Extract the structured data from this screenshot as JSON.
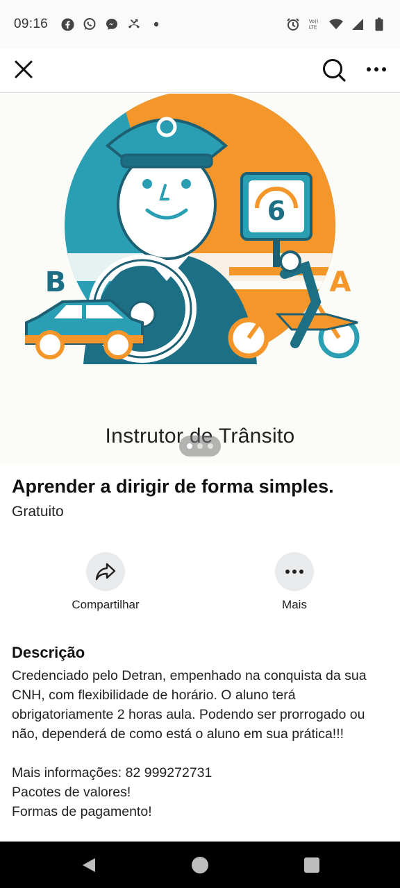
{
  "status_bar": {
    "time": "09:16",
    "left_icons": [
      "facebook-icon",
      "whatsapp-icon",
      "messenger-icon",
      "missed-call-icon",
      "dot-icon"
    ],
    "right_icons": [
      "alarm-icon",
      "volte-icon",
      "wifi-icon",
      "signal-icon",
      "battery-icon"
    ],
    "volte_label": "Vo)) LTE"
  },
  "app_bar": {
    "close_icon": "close-icon",
    "search_icon": "search-icon",
    "more_icon": "more-horizontal-icon"
  },
  "hero": {
    "caption": "Instrutor de Trânsito",
    "badge_number": "6",
    "left_letter": "B",
    "right_letter": "A",
    "pager": {
      "count": 3,
      "active_index": 0
    },
    "colors": {
      "teal": "#2a9fb4",
      "orange": "#f5962a",
      "navy": "#1d5f73"
    }
  },
  "listing": {
    "title": "Aprender a dirigir de forma simples.",
    "price": "Gratuito"
  },
  "actions": {
    "share_label": "Compartilhar",
    "more_label": "Mais"
  },
  "description": {
    "heading": "Descrição",
    "body": "Credenciado pelo Detran, empenhado na conquista da sua CNH, com flexibilidade de horário. O aluno terá obrigatoriamente 2 horas aula. Podendo ser prorrogado ou não, dependerá de como está o aluno em sua prática!!!\n\nMais informações: 82 999272731\nPacotes de valores!\nFormas de pagamento!"
  }
}
